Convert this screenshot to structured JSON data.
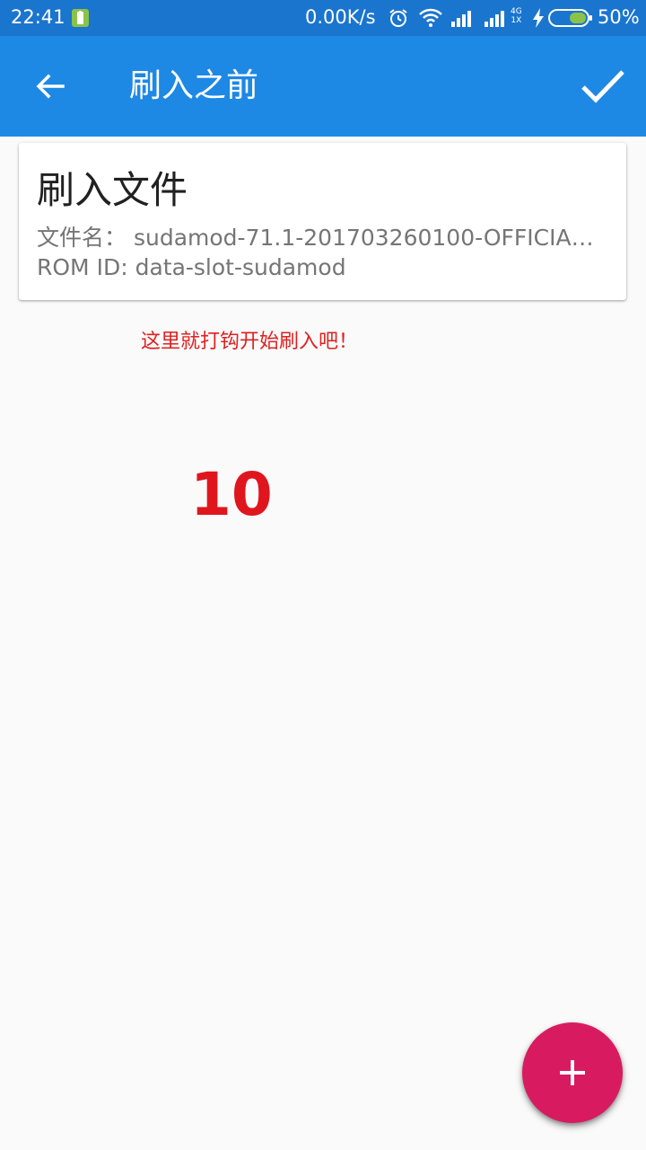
{
  "status_bar": {
    "time": "22:41",
    "network_speed": "0.00K/s",
    "network_type_top": "4G",
    "network_type_bottom": "1X",
    "battery_percent": "50%",
    "battery_level": 0.5,
    "icons": [
      "battery-saver-icon",
      "alarm-icon",
      "wifi-icon",
      "signal-icon",
      "signal-icon",
      "charging-icon",
      "battery-icon"
    ],
    "color": "#1a75cf"
  },
  "app_bar": {
    "title": "刷入之前",
    "back_icon": "arrow-left-icon",
    "confirm_icon": "check-icon",
    "color": "#1e88e5"
  },
  "card": {
    "title": "刷入文件",
    "filename_label": "文件名：",
    "filename_value": "sudamod-71.1-201703260100-OFFICIAL-…",
    "romid_label": "ROM ID:",
    "romid_value": "data-slot-sudamod"
  },
  "annotation": {
    "hint": "这里就打钩开始刷入吧！",
    "number": "10",
    "color": "#e0161e"
  },
  "fab": {
    "icon": "plus-icon",
    "color": "#d81b60"
  }
}
